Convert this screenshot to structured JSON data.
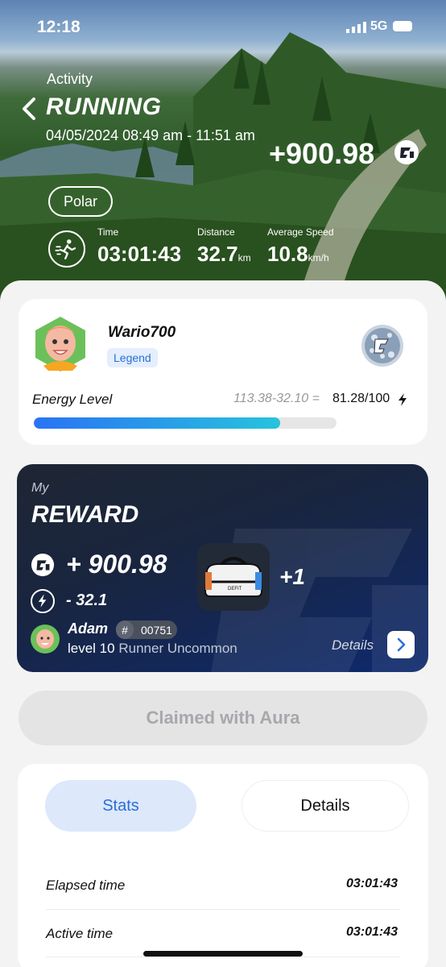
{
  "status_bar": {
    "time": "12:18",
    "network": "5G"
  },
  "header": {
    "section_label": "Activity",
    "title": "RUNNING",
    "date_range": "04/05/2024 08:49 am - 11:51 am",
    "reward_total": "+900.98",
    "source": "Polar"
  },
  "summary_stats": [
    {
      "label": "Time",
      "value": "03:01:43",
      "unit": ""
    },
    {
      "label": "Distance",
      "value": "32.7",
      "unit": "km"
    },
    {
      "label": "Average Speed",
      "value": "10.8",
      "unit": "km/h"
    }
  ],
  "profile": {
    "username": "Wario700",
    "rank_badge": "Legend",
    "energy_label": "Energy Level",
    "energy_calc": "113.38-32.10 =",
    "energy_value": "81.28/100",
    "energy_fraction": 0.8128
  },
  "reward_card": {
    "kicker": "My",
    "title": "REWARD",
    "amount": "+ 900.98",
    "energy_cost": "- 32.1",
    "item_bonus": "+1",
    "owner_name": "Adam",
    "owner_hash_symbol": "#",
    "owner_id": "00751",
    "owner_level": "level 10",
    "owner_class": "Runner Uncommon",
    "details_label": "Details"
  },
  "claim_button": {
    "label": "Claimed with Aura"
  },
  "tabs": [
    {
      "label": "Stats",
      "active": true
    },
    {
      "label": "Details",
      "active": false
    }
  ],
  "stats_rows": [
    {
      "label": "Elapsed time",
      "value": "03:01:43"
    },
    {
      "label": "Active time",
      "value": "03:01:43"
    }
  ],
  "colors": {
    "accent": "#2a6ed8",
    "energy_bar_start": "#2a73f5",
    "energy_bar_end": "#27c3dc",
    "reward_card_bg": "#19253f"
  }
}
